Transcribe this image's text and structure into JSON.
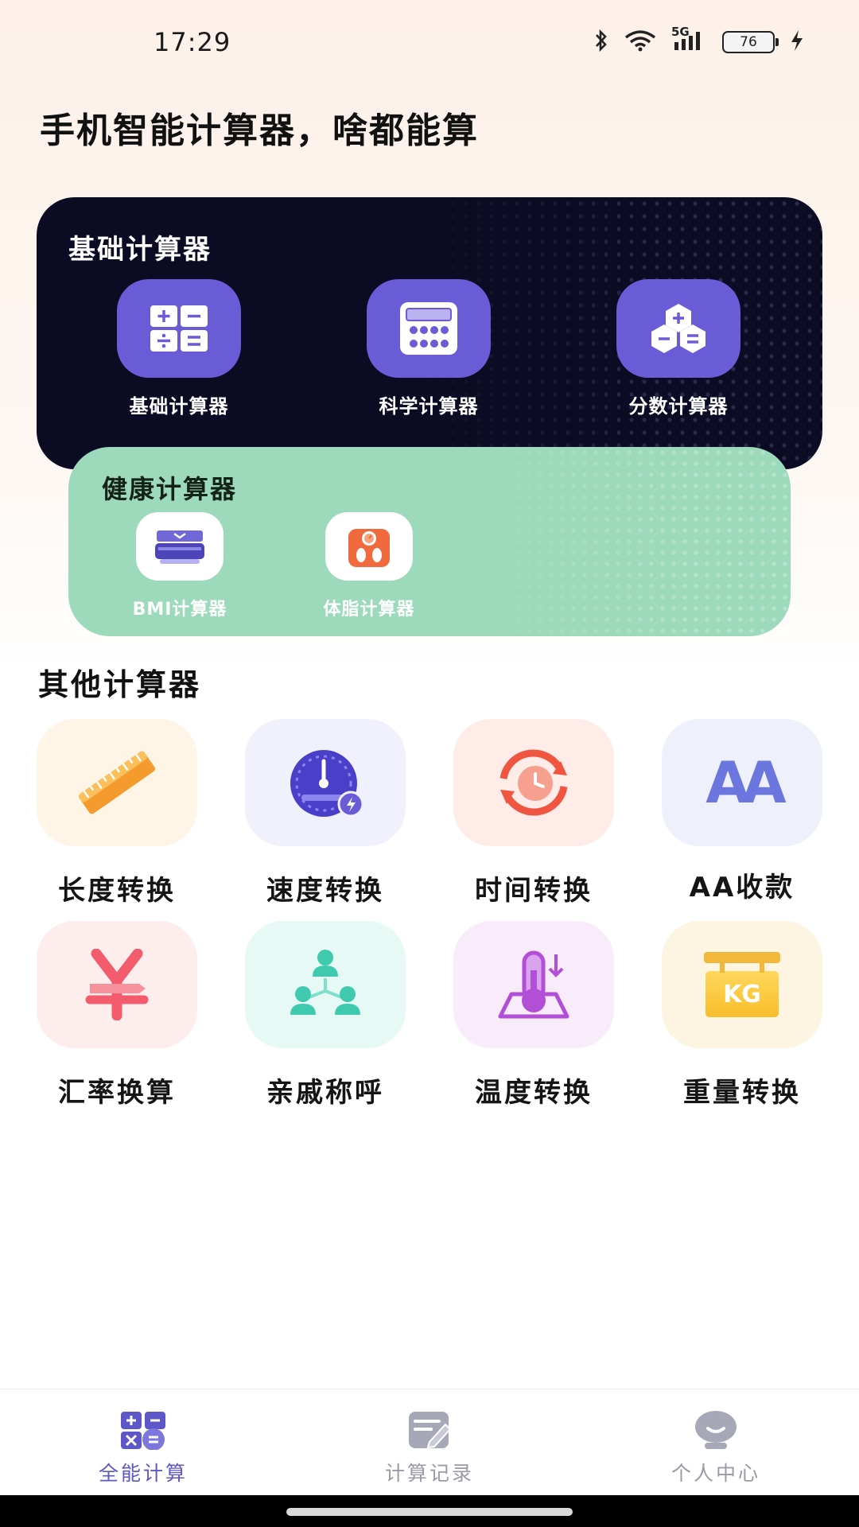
{
  "status_bar": {
    "time": "17:29",
    "network": "5G",
    "battery": "76"
  },
  "headline": "手机智能计算器，啥都能算",
  "basic_section": {
    "title": "基础计算器",
    "items": [
      {
        "label": "基础计算器",
        "icon": "basic-calculator-icon"
      },
      {
        "label": "科学计算器",
        "icon": "scientific-calculator-icon"
      },
      {
        "label": "分数计算器",
        "icon": "fraction-calculator-icon"
      }
    ]
  },
  "health_section": {
    "title": "健康计算器",
    "items": [
      {
        "label": "BMI计算器",
        "icon": "bmi-scale-icon"
      },
      {
        "label": "体脂计算器",
        "icon": "body-fat-scale-icon"
      }
    ]
  },
  "other_section": {
    "title": "其他计算器",
    "items": [
      {
        "label": "长度转换",
        "icon": "ruler-icon"
      },
      {
        "label": "速度转换",
        "icon": "speedometer-icon"
      },
      {
        "label": "时间转换",
        "icon": "clock-cycle-icon"
      },
      {
        "label": "AA收款",
        "icon": "aa-icon",
        "glyph": "AA"
      },
      {
        "label": "汇率换算",
        "icon": "yen-currency-icon"
      },
      {
        "label": "亲戚称呼",
        "icon": "family-tree-icon"
      },
      {
        "label": "温度转换",
        "icon": "thermometer-icon"
      },
      {
        "label": "重量转换",
        "icon": "kg-weight-icon",
        "glyph": "KG"
      }
    ]
  },
  "bottom_nav": {
    "items": [
      {
        "label": "全能计算",
        "active": true
      },
      {
        "label": "计算记录",
        "active": false
      },
      {
        "label": "个人中心",
        "active": false
      }
    ]
  },
  "colors": {
    "accent": "#6a5cd6",
    "dark_card": "#0b0b24",
    "health_card": "#9dd9bb",
    "nav_active": "#5d57c9",
    "nav_inactive": "#9a9aa8"
  }
}
